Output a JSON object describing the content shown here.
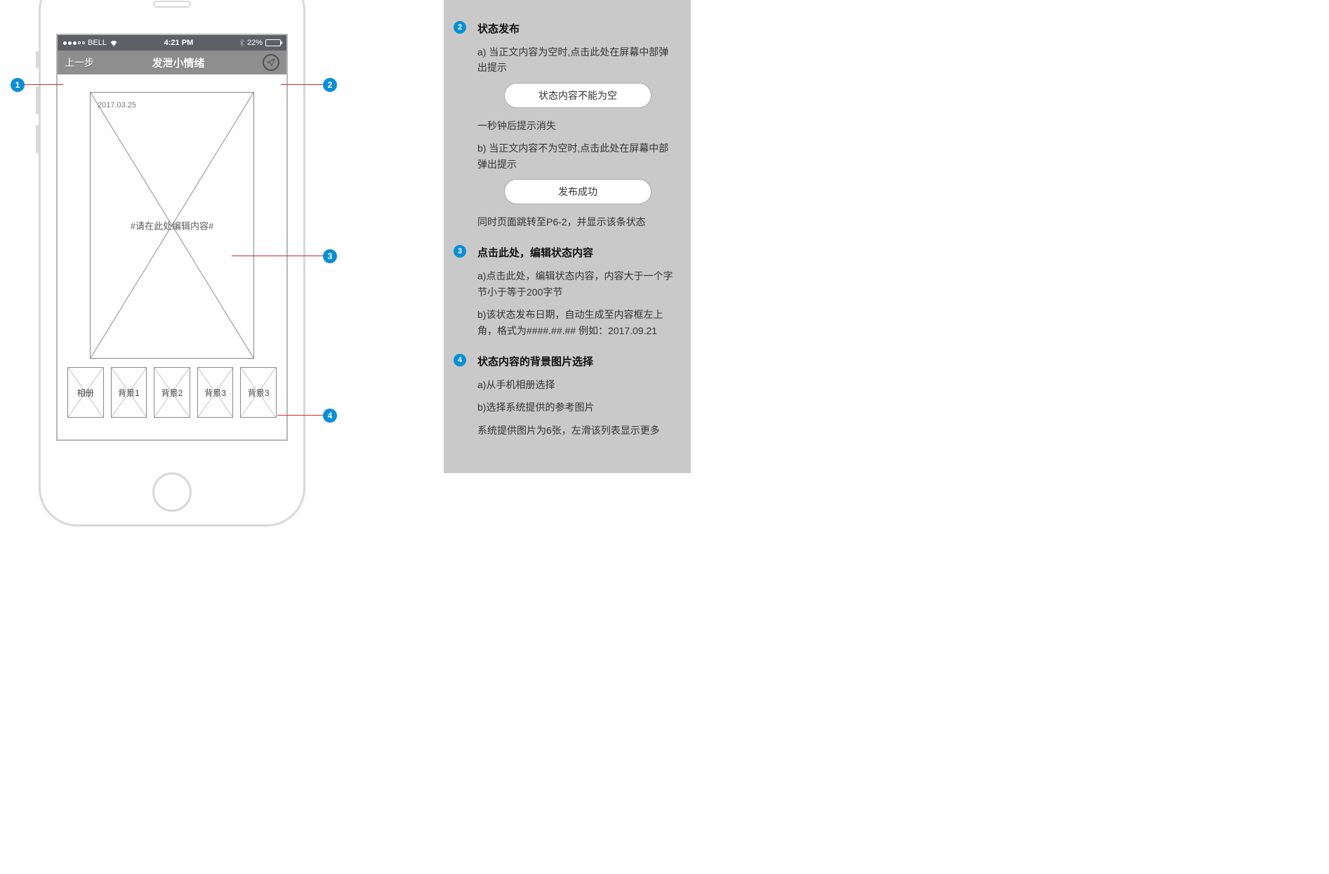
{
  "phone": {
    "status_bar": {
      "carrier": "BELL",
      "time": "4:21 PM",
      "battery_pct": "22%"
    },
    "nav": {
      "back": "上一步",
      "title": "发泄小情绪"
    },
    "editor": {
      "date": "2017.03.25",
      "placeholder": "#请在此处编辑内容#"
    },
    "thumbs": [
      "相册",
      "背景1",
      "背景2",
      "背景3",
      "背景3"
    ]
  },
  "markers": {
    "m1": "1",
    "m2": "2",
    "m3": "3",
    "m4": "4"
  },
  "spec": {
    "items": [
      {
        "num": "2",
        "title": "状态发布",
        "paras_a": [
          "a) 当正文内容为空时,点击此处在屏幕中部弹出提示"
        ],
        "pill_a": "状态内容不能为空",
        "paras_b": [
          "一秒钟后提示消失",
          "b) 当正文内容不为空时,点击此处在屏幕中部弹出提示"
        ],
        "pill_b": "发布成功",
        "paras_c": [
          "同时页面跳转至P6-2，并显示该条状态"
        ]
      },
      {
        "num": "3",
        "title": "点击此处，编辑状态内容",
        "paras": [
          "a)点击此处，编辑状态内容，内容大于一个字节小于等于200字节",
          "b)该状态发布日期，自动生成至内容框左上角，格式为####.##.##  例如：2017.09.21"
        ]
      },
      {
        "num": "4",
        "title": "状态内容的背景图片选择",
        "paras": [
          "a)从手机相册选择",
          "b)选择系统提供的参考图片",
          "系统提供图片为6张，左滑该列表显示更多"
        ]
      }
    ]
  }
}
